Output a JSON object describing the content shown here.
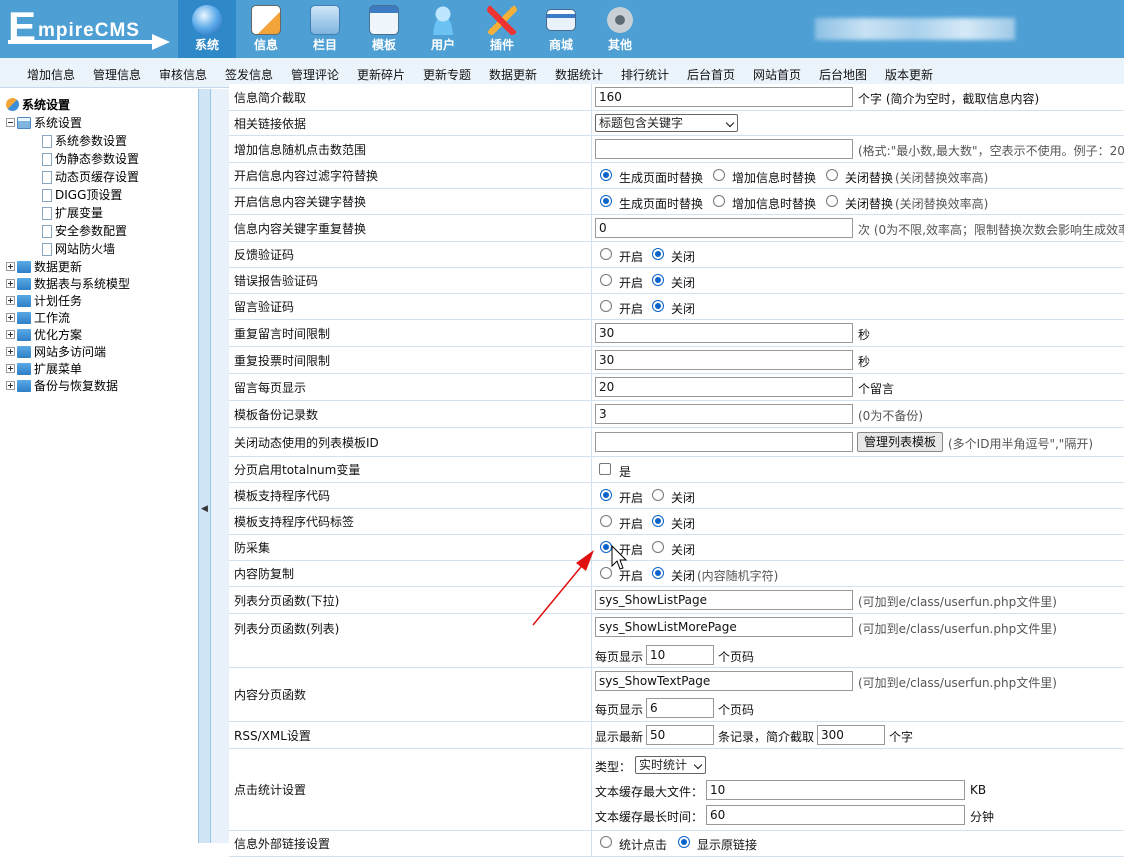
{
  "logo": {
    "big": "E",
    "text": "mpireCMS"
  },
  "main_tabs": [
    "系统",
    "信息",
    "栏目",
    "模板",
    "用户",
    "插件",
    "商城",
    "其他"
  ],
  "subnav": [
    "增加信息",
    "管理信息",
    "审核信息",
    "签发信息",
    "管理评论",
    "更新碎片",
    "更新专题",
    "数据更新",
    "数据统计",
    "排行统计",
    "后台首页",
    "网站首页",
    "后台地图",
    "版本更新"
  ],
  "sidebar": {
    "root": "系统设置",
    "open_group": "系统设置",
    "children": [
      "系统参数设置",
      "伪静态参数设置",
      "动态页缓存设置",
      "DIGG顶设置",
      "扩展变量",
      "安全参数配置",
      "网站防火墙"
    ],
    "groups": [
      "数据更新",
      "数据表与系统模型",
      "计划任务",
      "工作流",
      "优化方案",
      "网站多访问端",
      "扩展菜单",
      "备份与恢复数据"
    ]
  },
  "splitter_arrow": "◀",
  "radio": {
    "on_gen": "生成页面时替换",
    "on_add": "增加信息时替换",
    "off_replace": "关闭替换",
    "efficient": "(关闭替换效率高)",
    "open": "开启",
    "close": "关闭",
    "random": "(内容随机字符)",
    "count_stat": "统计点击",
    "show_orig": "显示原链接"
  },
  "rows": {
    "r1": {
      "label": "信息简介截取",
      "value": "160",
      "hint": "个字 (简介为空时，截取信息内容)"
    },
    "r2": {
      "label": "相关链接依据",
      "select": "标题包含关键字"
    },
    "r3": {
      "label": "增加信息随机点击数范围",
      "value": "",
      "hint": "(格式:\"最小数,最大数\"，空表示不使用。例子：20,"
    },
    "r4": {
      "label": "开启信息内容过滤字符替换"
    },
    "r5": {
      "label": "开启信息内容关键字替换"
    },
    "r6": {
      "label": "信息内容关键字重复替换",
      "value": "0",
      "hint": "次 (0为不限,效率高；限制替换次数会影响生成效率"
    },
    "r7": {
      "label": "反馈验证码"
    },
    "r8": {
      "label": "错误报告验证码"
    },
    "r9": {
      "label": "留言验证码"
    },
    "r10": {
      "label": "重复留言时间限制",
      "value": "30",
      "hint": "秒"
    },
    "r11": {
      "label": "重复投票时间限制",
      "value": "30",
      "hint": "秒"
    },
    "r12": {
      "label": "留言每页显示",
      "value": "20",
      "hint": "个留言"
    },
    "r13": {
      "label": "模板备份记录数",
      "value": "3",
      "hint": "(0为不备份)"
    },
    "r14": {
      "label": "关闭动态使用的列表模板ID",
      "value": "",
      "button": "管理列表模板",
      "hint": "(多个ID用半角逗号\",\"隔开)"
    },
    "r15": {
      "label": "分页启用totalnum变量",
      "check": "是"
    },
    "r16": {
      "label": "模板支持程序代码"
    },
    "r17": {
      "label": "模板支持程序代码标签"
    },
    "r18": {
      "label": "防采集"
    },
    "r19": {
      "label": "内容防复制"
    },
    "r20": {
      "label": "列表分页函数(下拉)",
      "value": "sys_ShowListPage",
      "hint": "(可加到e/class/userfun.php文件里)"
    },
    "r21": {
      "label": "列表分页函数(列表)",
      "value": "sys_ShowListMorePage",
      "hint": "(可加到e/class/userfun.php文件里)",
      "per": "每页显示",
      "pervalue": "10",
      "unit": "个页码"
    },
    "r22": {
      "label": "内容分页函数",
      "value": "sys_ShowTextPage",
      "hint": "(可加到e/class/userfun.php文件里)",
      "per": "每页显示",
      "pervalue": "6",
      "unit": "个页码"
    },
    "r23": {
      "label": "RSS/XML设置",
      "show": "显示最新",
      "count": "50",
      "mid": "条记录，简介截取",
      "len": "300",
      "unit": "个字"
    },
    "r24": {
      "label": "点击统计设置",
      "type_label": "类型：",
      "type": "实时统计",
      "maxfile_label": "文本缓存最大文件：",
      "maxfile": "10",
      "maxfile_unit": "KB",
      "maxtime_label": "文本缓存最长时间：",
      "maxtime": "60",
      "maxtime_unit": "分钟"
    },
    "r25": {
      "label": "信息外部链接设置"
    }
  },
  "colors": {
    "header": "#4d9fd4",
    "active_tab": "#2f88c8",
    "subnav": "#ecf4fb",
    "annotation_arrow": "#e01010"
  }
}
